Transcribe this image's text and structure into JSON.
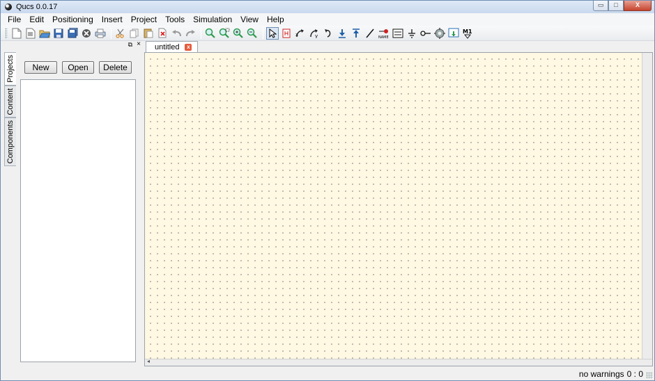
{
  "window": {
    "title": "Qucs 0.0.17",
    "controls": [
      "▭",
      "□",
      "X"
    ]
  },
  "menubar": {
    "items": [
      "File",
      "Edit",
      "Positioning",
      "Insert",
      "Project",
      "Tools",
      "Simulation",
      "View",
      "Help"
    ]
  },
  "toolbar": {
    "groups": [
      [
        "new-file-icon",
        "text-file-icon",
        "open-folder-icon",
        "save-icon",
        "save-all-icon",
        "close-icon",
        "print-icon"
      ],
      [
        "cut-icon",
        "copy-icon",
        "paste-icon",
        "delete-icon",
        "undo-icon",
        "redo-icon"
      ],
      [
        "zoom-fit-icon",
        "zoom-selection-icon",
        "zoom-in-icon",
        "zoom-out-icon"
      ],
      [
        "select-icon",
        "edit-activate-icon",
        "mirror-x-icon",
        "mirror-y-icon",
        "rotate-icon",
        "push-down-icon",
        "pop-up-icon",
        "wire-icon",
        "wire-label-icon",
        "equation-icon",
        "ground-icon",
        "port-icon",
        "simulate-icon",
        "data-display-icon",
        "marker-icon"
      ]
    ],
    "active_tool": "select-icon"
  },
  "dock": {
    "float_label": "⧉",
    "close_label": "×",
    "side_tabs": [
      "Projects",
      "Content",
      "Components"
    ],
    "active_tab": "Projects",
    "buttons": {
      "new": "New",
      "open": "Open",
      "delete": "Delete"
    }
  },
  "document": {
    "tab_label": "untitled",
    "tab_close": "x",
    "hscroll_arrow": "◂"
  },
  "status": {
    "text": "no warnings",
    "cursor": "0 : 0"
  }
}
